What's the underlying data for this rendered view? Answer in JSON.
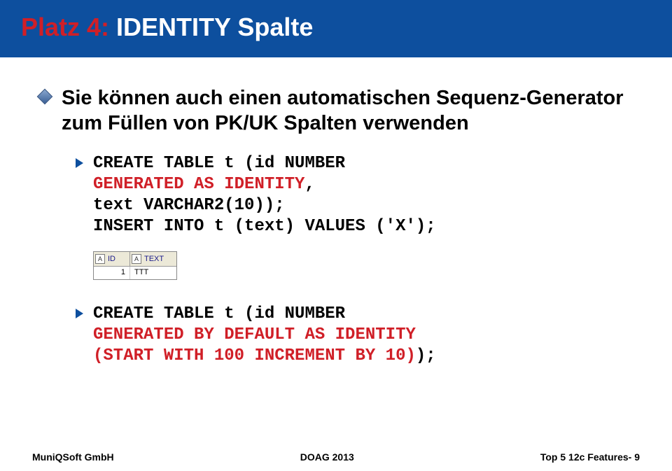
{
  "header": {
    "title_red": "Platz 4:",
    "title_white": " IDENTITY Spalte"
  },
  "main_bullet": "Sie können auch einen automatischen Sequenz-Generator zum Füllen von PK/UK Spalten verwenden",
  "code1": {
    "line1_black": "CREATE TABLE t (id NUMBER",
    "line2_red": "GENERATED AS IDENTITY",
    "line2_black": ",",
    "line3_black": "text VARCHAR2(10));",
    "line4_black": "INSERT INTO t (text) VALUES ('X');"
  },
  "table": {
    "col1": "ID",
    "col2": "TEXT",
    "row1_id": "1",
    "row1_text": "TTT"
  },
  "code2": {
    "line1_black": "CREATE TABLE t (id NUMBER",
    "line2_red": "GENERATED BY DEFAULT AS IDENTITY",
    "line3_red": "(START WITH 100 INCREMENT BY 10)",
    "line3_black": ");"
  },
  "footer": {
    "left": "MuniQSoft GmbH",
    "center": "DOAG 2013",
    "right": "Top 5 12c Features- 9"
  }
}
